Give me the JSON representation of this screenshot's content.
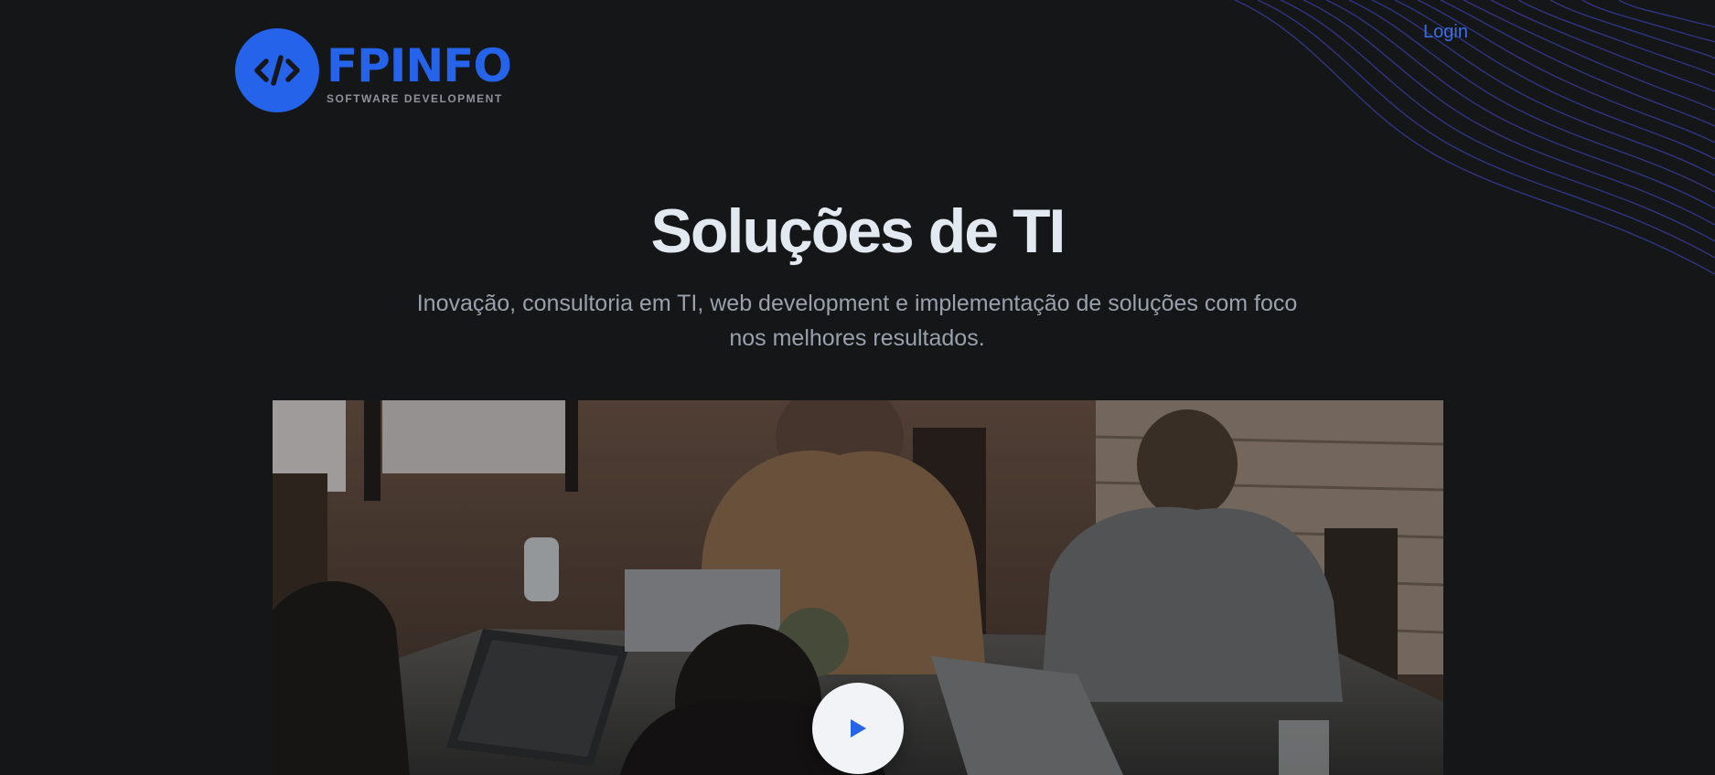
{
  "header": {
    "brand_name": "FPINFO",
    "brand_tagline": "SOFTWARE DEVELOPMENT",
    "login_label": "Login"
  },
  "hero": {
    "title": "Soluções de TI",
    "subtitle": "Inovação, consultoria em TI, web development e implementação de soluções com foco nos melhores resultados."
  },
  "icons": {
    "logo": "code-brackets-icon",
    "play": "play-icon"
  },
  "colors": {
    "background": "#151618",
    "accent": "#2563eb",
    "title": "#e3e9f1",
    "subtitle": "#99a1ad",
    "waves": "#3b3fa8"
  }
}
